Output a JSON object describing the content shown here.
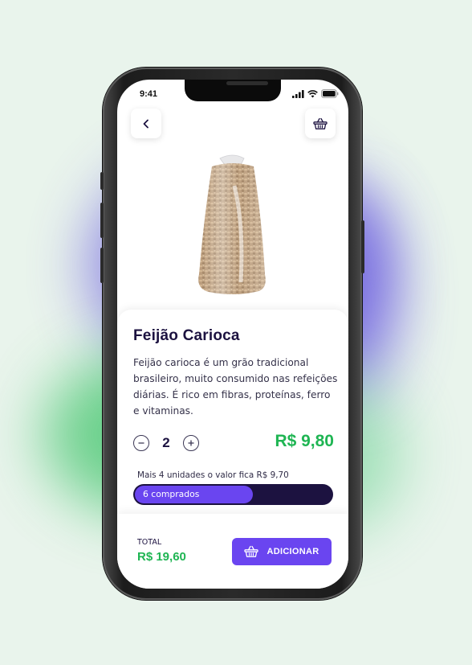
{
  "status_bar": {
    "time": "9:41"
  },
  "product": {
    "name": "Feijão Carioca",
    "description": "Feijão carioca é um grão tradicional brasileiro, muito consumido nas refeições diárias. É rico em fibras, proteínas, ferro e vitaminas.",
    "quantity": "2",
    "price": "R$ 9,80"
  },
  "promo": {
    "text": "Mais 4 unidades o valor fica R$ 9,70",
    "progress_label": "6 comprados",
    "progress_fraction": 0.6
  },
  "footer": {
    "total_label": "TOTAL",
    "total_value": "R$ 19,60",
    "add_button_label": "ADICIONAR"
  },
  "colors": {
    "accent": "#6a45f0",
    "price_green": "#1fb553",
    "dark_navy": "#1c1240"
  },
  "icons": [
    "back-icon",
    "basket-icon",
    "minus-icon",
    "plus-icon",
    "signal-icon",
    "wifi-icon",
    "battery-icon"
  ]
}
